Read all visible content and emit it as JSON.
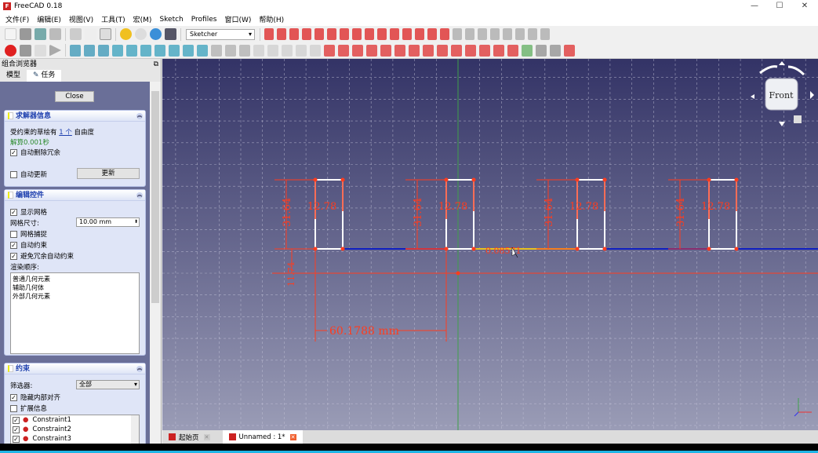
{
  "window": {
    "title": "FreeCAD 0.18",
    "controls": [
      "—",
      "☐",
      "✕"
    ]
  },
  "menu": [
    "文件(F)",
    "编辑(E)",
    "视图(V)",
    "工具(T)",
    "宏(M)",
    "Sketch",
    "Profiles",
    "窗口(W)",
    "帮助(H)"
  ],
  "toolbar": {
    "workbench": "Sketcher"
  },
  "combo_view": {
    "title": "组合浏览器",
    "tabs": [
      "模型",
      "任务"
    ],
    "close_label": "Close"
  },
  "solver": {
    "title": "求解器信息",
    "dof_prefix": "受约束的草绘有",
    "dof_link": "1 个",
    "dof_suffix": "自由度",
    "solve_time": "解算0.001秒",
    "auto_remove_redundant": {
      "label": "自动删除冗余",
      "checked": true
    },
    "auto_update": {
      "label": "自动更新",
      "checked": false
    },
    "update_button": "更新"
  },
  "edit_controls": {
    "title": "编辑控件",
    "show_grid": {
      "label": "显示网格",
      "checked": true
    },
    "grid_size_label": "网格尺寸:",
    "grid_size": "10.00 mm",
    "grid_snap": {
      "label": "网格捕捉",
      "checked": false
    },
    "auto_constraints": {
      "label": "自动约束",
      "checked": true
    },
    "avoid_redundant": {
      "label": "避免冗余自动约束",
      "checked": true
    },
    "render_order_label": "渲染顺序:",
    "render_order": [
      "普通几何元素",
      "辅助几何体",
      "外部几何元素"
    ]
  },
  "constraints": {
    "title": "约束",
    "filter_label": "筛选器:",
    "filter_value": "全部",
    "hide_internal": {
      "label": "隐藏内部对齐",
      "checked": true
    },
    "extended_info": {
      "label": "扩展信息",
      "checked": false
    },
    "items": [
      "Constraint1",
      "Constraint2",
      "Constraint3"
    ]
  },
  "sketch": {
    "dim_height": "31.64",
    "dim_width": "12.78",
    "dim_offset": "11.74",
    "dim_spacing": "60.1788 mm",
    "dim_small": "0.08571"
  },
  "navcube": {
    "face": "Front"
  },
  "doc_tabs": [
    "起始页",
    "Unnamed : 1*"
  ],
  "colors": {
    "accent": "#1d3fae",
    "constraint": "#ff3c1e",
    "viewport_top": "#333366"
  }
}
